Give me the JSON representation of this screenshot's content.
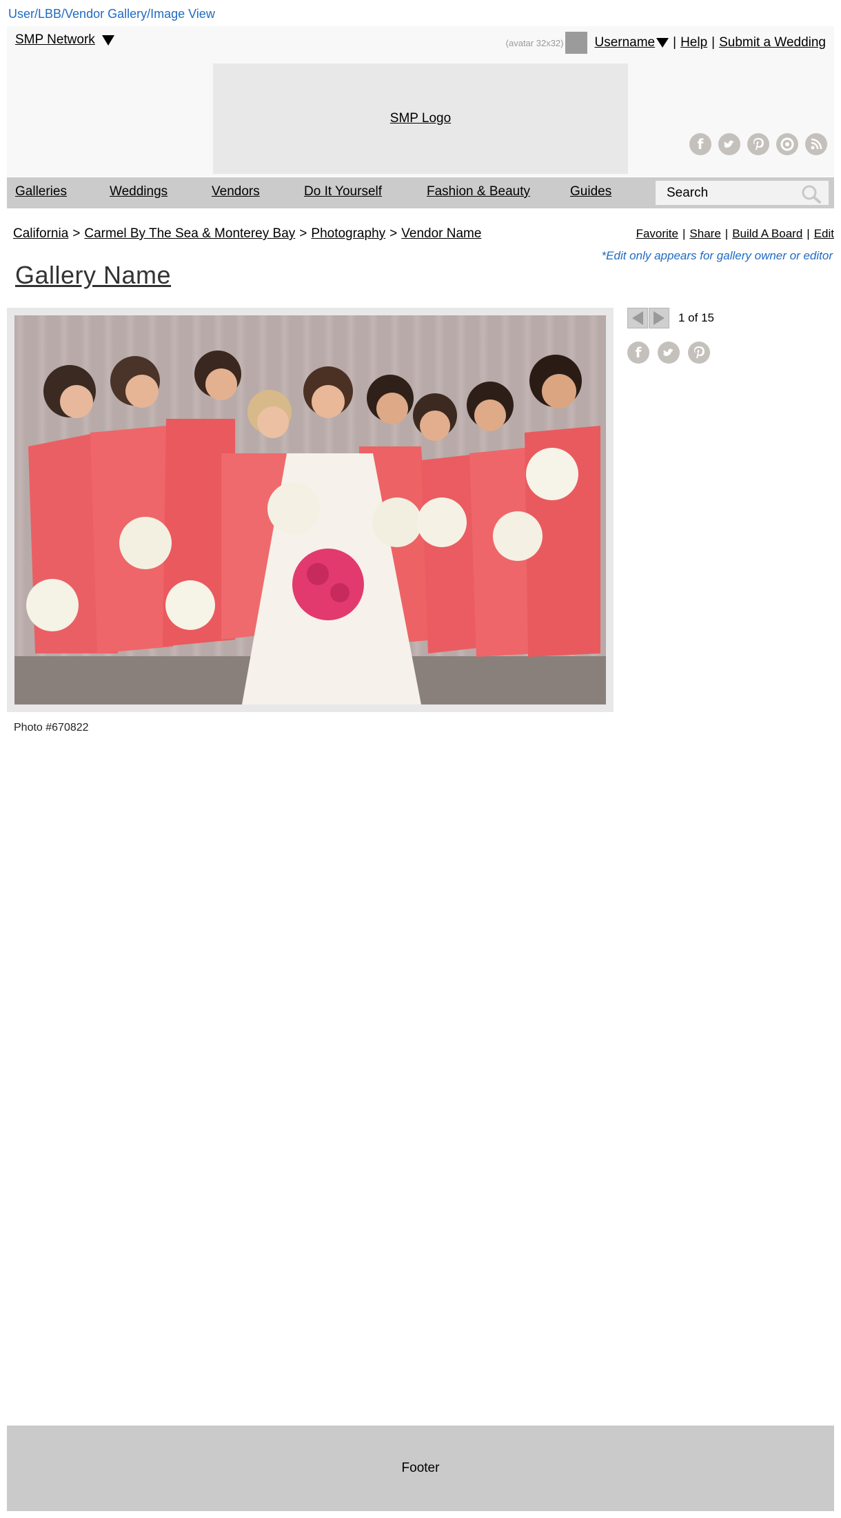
{
  "wireframe_label": "User/LBB/Vendor Gallery/Image View",
  "header": {
    "network": "SMP Network",
    "avatar_label": "(avatar 32x32)",
    "username": "Username",
    "help": "Help",
    "submit": "Submit a Wedding",
    "logo": "SMP Logo",
    "social_icons": [
      "facebook-icon",
      "twitter-icon",
      "pinterest-icon",
      "instagram-icon",
      "rss-icon"
    ]
  },
  "nav": {
    "items": [
      "Galleries",
      "Weddings",
      "Vendors",
      "Do It Yourself",
      "Fashion & Beauty",
      "Guides"
    ],
    "search_placeholder": "Search"
  },
  "breadcrumb": [
    "California",
    "Carmel By The Sea & Monterey Bay",
    "Photography",
    "Vendor Name"
  ],
  "actions": [
    "Favorite",
    "Share",
    "Build A Board",
    "Edit"
  ],
  "edit_note": "*Edit only appears for gallery owner or editor",
  "gallery_title": "Gallery Name",
  "photo": {
    "caption": "Photo #670822"
  },
  "pager": {
    "status": "1 of 15"
  },
  "share_icons": [
    "facebook-icon",
    "twitter-icon",
    "pinterest-icon"
  ],
  "footer": "Footer",
  "colors": {
    "link_blue": "#1f6bc1",
    "header_bg": "#f8f8f8",
    "nav_bg": "#cbcbcb",
    "icon_gray": "#c4c1bc",
    "footer_bg": "#cacaca"
  }
}
